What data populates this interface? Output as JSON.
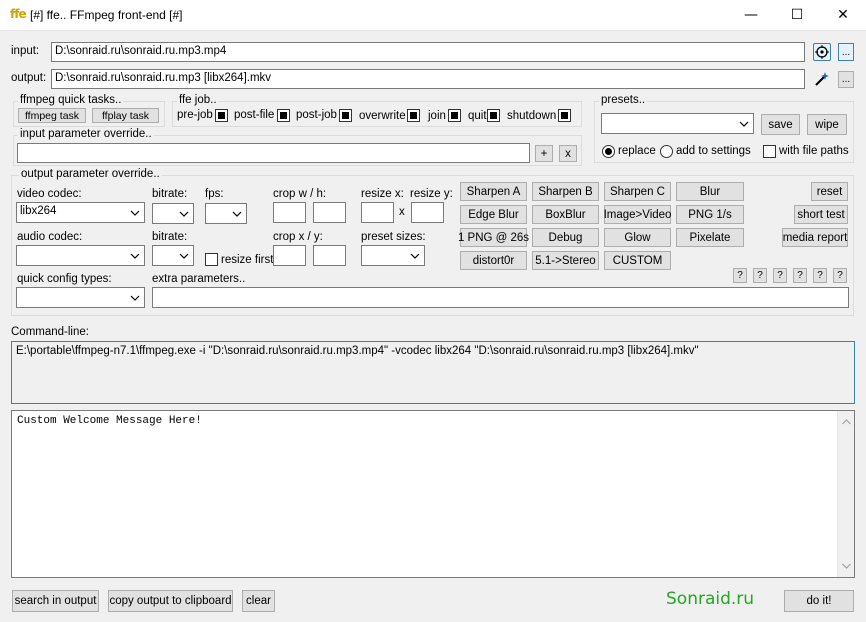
{
  "window": {
    "icon_text": "ffe",
    "title": "[#]  ffe.. FFmpeg front-end [#]",
    "minimize_glyph": "—",
    "maximize_glyph": "☐",
    "close_glyph": "✕"
  },
  "io": {
    "input_label": "input:",
    "input_value": "D:\\sonraid.ru\\sonraid.ru.mp3.mp4",
    "output_label": "output:",
    "output_value": "D:\\sonraid.ru\\sonraid.ru.mp3 [libx264].mkv",
    "browse_label": "..."
  },
  "quick_tasks": {
    "title": "ffmpeg quick tasks..",
    "ffmpeg_task": "ffmpeg task",
    "ffplay_task": "ffplay task"
  },
  "ffe_job": {
    "title": "ffe job..",
    "items": [
      "pre-job",
      "post-file",
      "post-job",
      "overwrite",
      "join",
      "quit",
      "shutdown"
    ]
  },
  "presets": {
    "title": "presets..",
    "save": "save",
    "wipe": "wipe",
    "replace": "replace",
    "add_to_settings": "add to  settings",
    "with_file_paths": "with file paths"
  },
  "input_override": {
    "title": "input parameter override..",
    "plus": "+",
    "x": "x"
  },
  "output_override": {
    "title": "output parameter override..",
    "video_codec_label": "video codec:",
    "video_codec_value": "libx264",
    "bitrate_label": "bitrate:",
    "fps_label": "fps:",
    "crop_wh_label": "crop  w / h:",
    "resize_x_label": "resize x:",
    "resize_y_label": "resize y:",
    "x_sep": "x",
    "audio_codec_label": "audio codec:",
    "audio_bitrate_label": "bitrate:",
    "resize_first_label": "resize first",
    "crop_xy_label": "crop  x / y:",
    "preset_sizes_label": "preset sizes:",
    "quick_config_label": "quick config types:",
    "extra_params_label": "extra parameters.."
  },
  "filters": {
    "row1": [
      "Sharpen A",
      "Sharpen B",
      "Sharpen C",
      "Blur"
    ],
    "row2": [
      "Edge Blur",
      "BoxBlur",
      "Image>Video",
      "PNG 1/s"
    ],
    "row3": [
      "1 PNG @ 26s",
      "Debug",
      "Glow",
      "Pixelate"
    ],
    "row4": [
      "distort0r",
      "5.1->Stereo",
      "CUSTOM"
    ],
    "reset": "reset",
    "short_test": "short test",
    "media_report": "media report",
    "help": [
      "?",
      "?",
      "?",
      "?",
      "?",
      "?"
    ]
  },
  "cmdline": {
    "label": "Command-line:",
    "text": "E:\\portable\\ffmpeg-n7.1\\ffmpeg.exe  -i \"D:\\sonraid.ru\\sonraid.ru.mp3.mp4\" -vcodec libx264   \"D:\\sonraid.ru\\sonraid.ru.mp3 [libx264].mkv\""
  },
  "console": {
    "text": "Custom Welcome Message Here!"
  },
  "bottom": {
    "search": "search in output",
    "copy": "copy output to clipboard",
    "clear": "clear",
    "brand": "Sonraid.ru",
    "doit": "do it!"
  },
  "colors": {
    "brand_green": "#22a822",
    "cmd_border": "#3c7fb1",
    "cmd_bg": "#f0f0f0"
  }
}
